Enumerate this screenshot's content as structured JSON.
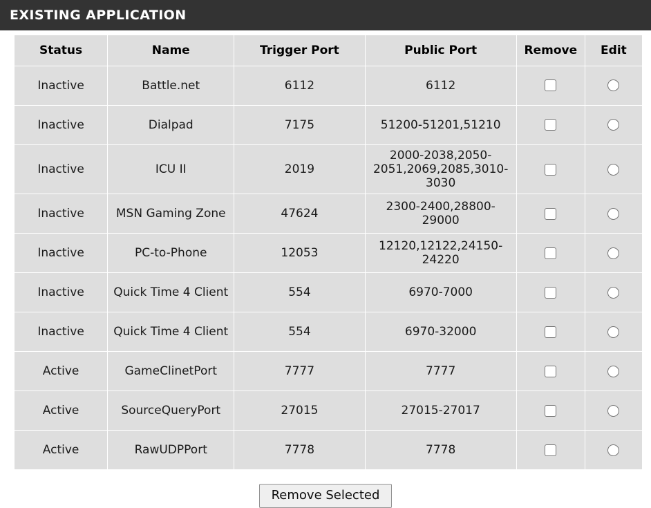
{
  "header": {
    "title": "EXISTING APPLICATION"
  },
  "table": {
    "columns": [
      {
        "key": "status",
        "label": "Status"
      },
      {
        "key": "name",
        "label": "Name"
      },
      {
        "key": "trigger",
        "label": "Trigger Port"
      },
      {
        "key": "public",
        "label": "Public Port"
      },
      {
        "key": "remove",
        "label": "Remove"
      },
      {
        "key": "edit",
        "label": "Edit"
      }
    ],
    "rows": [
      {
        "status": "Inactive",
        "status_state": "inactive",
        "name": "Battle.net",
        "trigger": "6112",
        "public": "6112",
        "remove_checked": false,
        "edit_selected": false
      },
      {
        "status": "Inactive",
        "status_state": "inactive",
        "name": "Dialpad",
        "trigger": "7175",
        "public": "51200-51201,51210",
        "remove_checked": false,
        "edit_selected": false
      },
      {
        "status": "Inactive",
        "status_state": "inactive",
        "name": "ICU II",
        "trigger": "2019",
        "public": "2000-2038,2050-2051,2069,2085,3010-3030",
        "remove_checked": false,
        "edit_selected": false
      },
      {
        "status": "Inactive",
        "status_state": "inactive",
        "name": "MSN Gaming Zone",
        "trigger": "47624",
        "public": "2300-2400,28800-29000",
        "remove_checked": false,
        "edit_selected": false
      },
      {
        "status": "Inactive",
        "status_state": "inactive",
        "name": "PC-to-Phone",
        "trigger": "12053",
        "public": "12120,12122,24150-24220",
        "remove_checked": false,
        "edit_selected": false
      },
      {
        "status": "Inactive",
        "status_state": "inactive",
        "name": "Quick Time 4 Client",
        "trigger": "554",
        "public": "6970-7000",
        "remove_checked": false,
        "edit_selected": false
      },
      {
        "status": "Inactive",
        "status_state": "inactive",
        "name": "Quick Time 4 Client",
        "trigger": "554",
        "public": "6970-32000",
        "remove_checked": false,
        "edit_selected": false
      },
      {
        "status": "Active",
        "status_state": "active",
        "name": "GameClinetPort",
        "trigger": "7777",
        "public": "7777",
        "remove_checked": false,
        "edit_selected": false
      },
      {
        "status": "Active",
        "status_state": "active",
        "name": "SourceQueryPort",
        "trigger": "27015",
        "public": "27015-27017",
        "remove_checked": false,
        "edit_selected": false
      },
      {
        "status": "Active",
        "status_state": "active",
        "name": "RawUDPPort",
        "trigger": "7778",
        "public": "7778",
        "remove_checked": false,
        "edit_selected": false
      }
    ]
  },
  "footer": {
    "remove_selected_label": "Remove Selected"
  },
  "colors": {
    "header_bg": "#333333",
    "cell_bg": "#dedede",
    "status_inactive": "#e23b3b",
    "status_active": "#2222cc",
    "page_bg": "#ffffff"
  }
}
